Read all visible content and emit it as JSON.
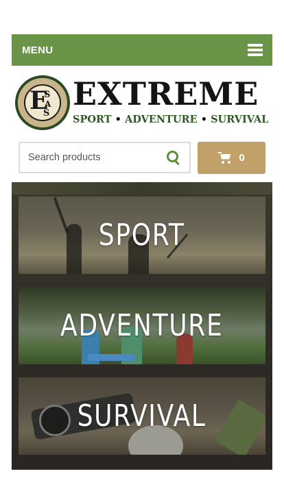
{
  "menu": {
    "label": "MENU"
  },
  "logo": {
    "seal_letters": {
      "big": "E",
      "s1": "S",
      "a": "A",
      "s2": "S"
    },
    "wordmark": "EXTREME",
    "tagline": [
      "SPORT",
      "ADVENTURE",
      "SURVIVAL"
    ],
    "tagline_separator": "•"
  },
  "search": {
    "placeholder": "Search products",
    "value": ""
  },
  "cart": {
    "count": "0"
  },
  "categories": [
    {
      "label": "SPORT"
    },
    {
      "label": "ADVENTURE"
    },
    {
      "label": "SURVIVAL"
    }
  ],
  "colors": {
    "menu_bar": "#6a9448",
    "search_icon": "#5c8b3a",
    "cart_button": "#c2a06a",
    "logo_tag": "#2e5a24"
  },
  "icons": {
    "menu": "hamburger-icon",
    "search": "search-icon",
    "cart": "cart-icon"
  }
}
